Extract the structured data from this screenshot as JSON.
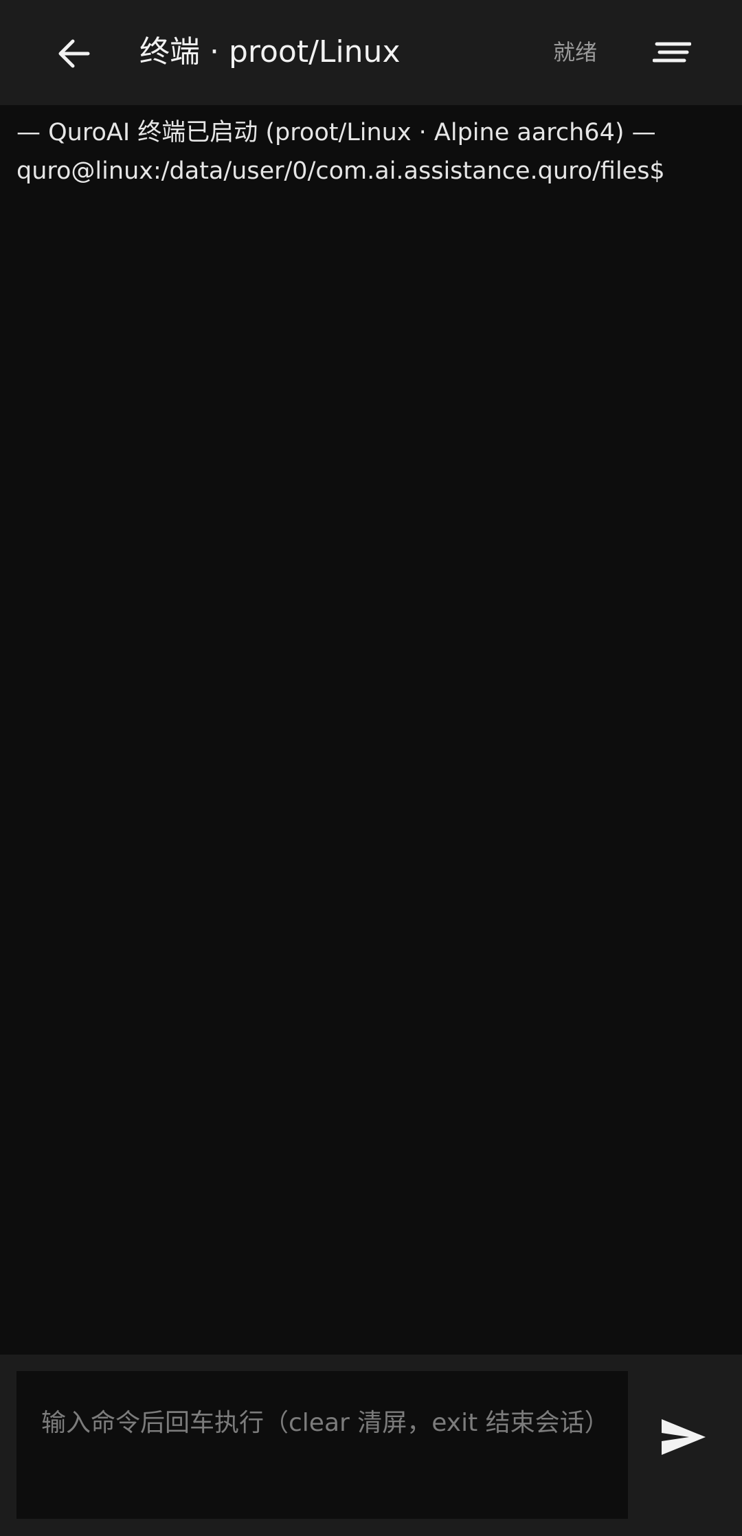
{
  "colors": {
    "topbar_bg": "#1c1c1c",
    "terminal_bg": "#0d0d0d",
    "text_primary": "#f2f2f2",
    "text_muted": "#9a9a9a",
    "placeholder": "#7c7c7c"
  },
  "header": {
    "back_icon": "arrow-left-icon",
    "title": "终端 · proot/Linux",
    "status": "就绪",
    "menu_icon": "text-lines-icon"
  },
  "terminal": {
    "lines": [
      "— QuroAI 终端已启动 (proot/Linux · Alpine aarch64) —",
      "quro@linux:/data/user/0/com.ai.assistance.quro/files$"
    ]
  },
  "input": {
    "placeholder": "输入命令后回车执行（clear 清屏，exit 结束会话）",
    "value": "",
    "send_icon": "send-icon"
  }
}
